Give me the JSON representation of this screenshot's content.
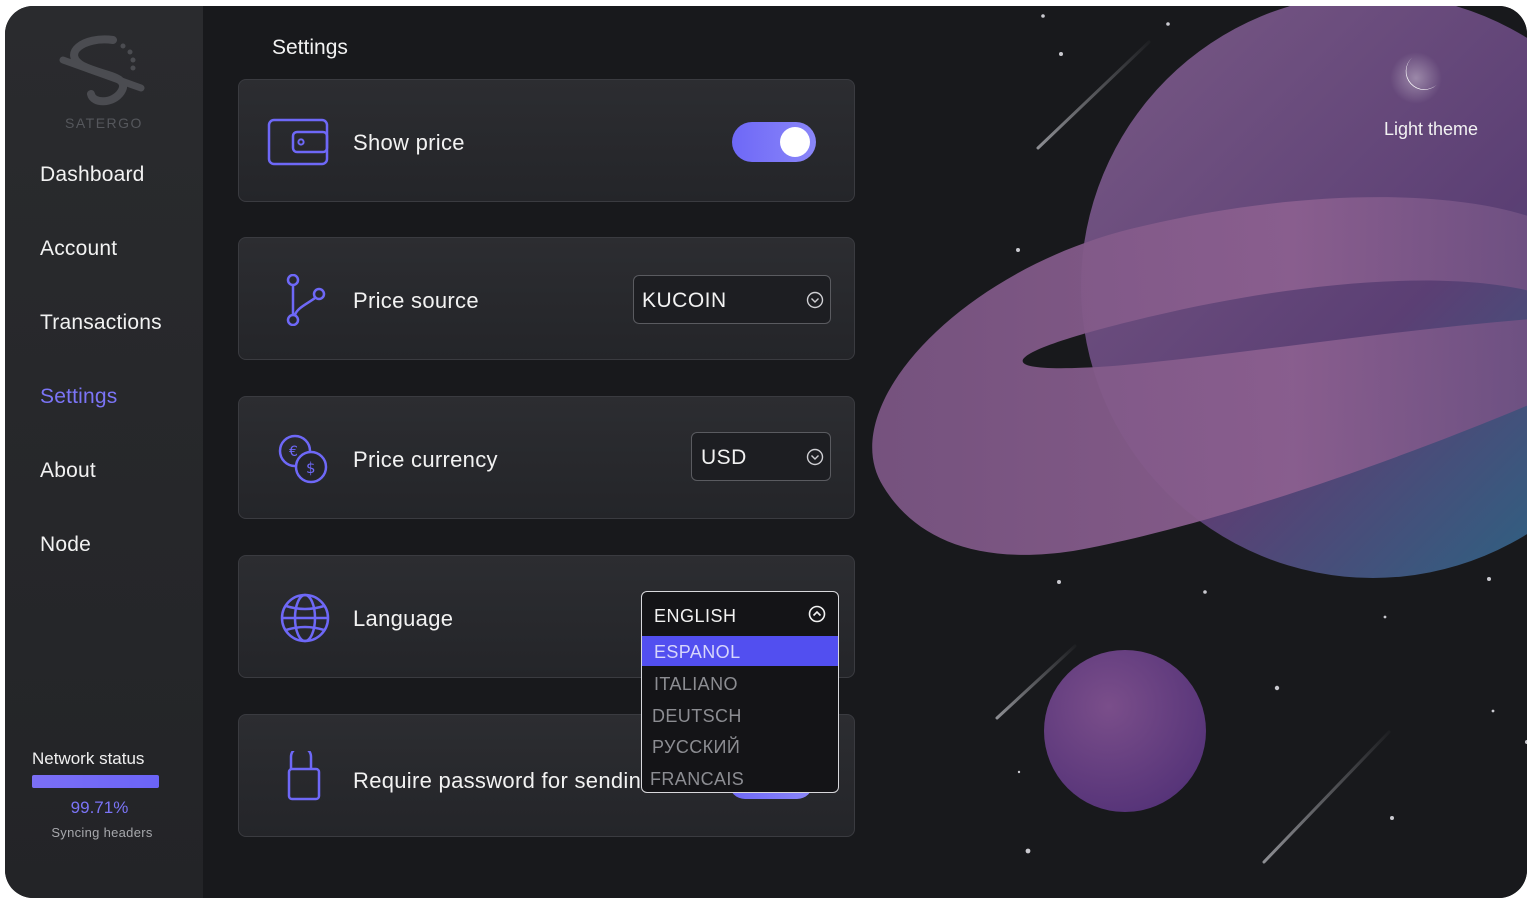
{
  "app": {
    "name": "SATERGO"
  },
  "sidebar": {
    "items": [
      {
        "label": "Dashboard",
        "active": false
      },
      {
        "label": "Account",
        "active": false
      },
      {
        "label": "Transactions",
        "active": false
      },
      {
        "label": "Settings",
        "active": true
      },
      {
        "label": "About",
        "active": false
      },
      {
        "label": "Node",
        "active": false
      }
    ],
    "network": {
      "label": "Network status",
      "progress_percent": 99.71,
      "percent_text": "99.71%",
      "status_text": "Syncing headers"
    }
  },
  "main": {
    "title": "Settings",
    "cards": {
      "show_price": {
        "label": "Show price",
        "toggle_on": true,
        "icon": "wallet-icon"
      },
      "price_source": {
        "label": "Price source",
        "value": "KUCOIN",
        "icon": "branch-icon"
      },
      "price_currency": {
        "label": "Price currency",
        "value": "USD",
        "icon": "currency-exchange-icon"
      },
      "language": {
        "label": "Language",
        "value": "ENGLISH",
        "icon": "globe-icon",
        "options": [
          "ESPANOL",
          "ITALIANO",
          "DEUTSCH",
          "РУССКИЙ",
          "FRANCAIS"
        ],
        "highlighted": "ESPANOL"
      },
      "require_password": {
        "label": "Require password for sending",
        "icon": "lock-icon"
      }
    }
  },
  "theme": {
    "label": "Light theme",
    "icon": "moon-icon"
  },
  "colors": {
    "accent": "#7b74f6",
    "background": "#18191c",
    "sidebar": "#27282b"
  }
}
